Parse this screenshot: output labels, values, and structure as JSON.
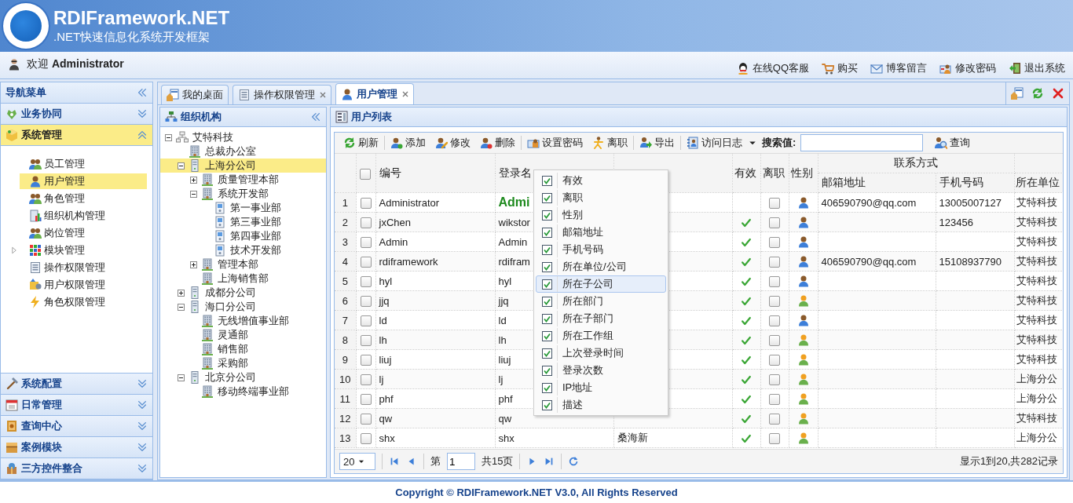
{
  "header": {
    "title": "RDIFramework.NET",
    "subtitle": ".NET快速信息化系统开发框架"
  },
  "welcome": {
    "prefix": "欢迎",
    "user": "Administrator"
  },
  "top_links": [
    "在线QQ客服",
    "购买",
    "博客留言",
    "修改密码",
    "退出系统"
  ],
  "nav": {
    "title": "导航菜单",
    "sections": [
      {
        "label": "业务协同",
        "expanded": false,
        "selected": false
      },
      {
        "label": "系统管理",
        "expanded": true,
        "selected": true,
        "items": [
          {
            "label": "员工管理",
            "selected": false
          },
          {
            "label": "用户管理",
            "selected": true
          },
          {
            "label": "角色管理",
            "selected": false
          },
          {
            "label": "组织机构管理",
            "selected": false
          },
          {
            "label": "岗位管理",
            "selected": false
          },
          {
            "label": "模块管理",
            "selected": false,
            "expanded": false
          },
          {
            "label": "操作权限管理",
            "selected": false
          },
          {
            "label": "用户权限管理",
            "selected": false
          },
          {
            "label": "角色权限管理",
            "selected": false
          }
        ]
      },
      {
        "label": "系统配置",
        "expanded": false,
        "selected": false
      },
      {
        "label": "日常管理",
        "expanded": false,
        "selected": false
      },
      {
        "label": "查询中心",
        "expanded": false,
        "selected": false
      },
      {
        "label": "案例模块",
        "expanded": false,
        "selected": false
      },
      {
        "label": "三方控件整合",
        "expanded": false,
        "selected": false
      }
    ]
  },
  "tabs": [
    {
      "label": "我的桌面",
      "closable": false,
      "selected": false
    },
    {
      "label": "操作权限管理",
      "closable": true,
      "selected": false
    },
    {
      "label": "用户管理",
      "closable": true,
      "selected": true
    }
  ],
  "tree": {
    "title": "组织机构",
    "nodes": [
      {
        "label": "艾特科技",
        "kind": "root",
        "expanded": true,
        "selected": false,
        "children": [
          {
            "label": "总裁办公室",
            "kind": "department",
            "selected": false
          },
          {
            "label": "上海分公司",
            "kind": "company",
            "expanded": true,
            "selected": true,
            "children": [
              {
                "label": "质量管理本部",
                "kind": "department",
                "expanded": false,
                "selected": false
              },
              {
                "label": "系统开发部",
                "kind": "department",
                "expanded": true,
                "selected": false,
                "children": [
                  {
                    "label": "第一事业部",
                    "kind": "unit",
                    "selected": false
                  },
                  {
                    "label": "第三事业部",
                    "kind": "unit",
                    "selected": false
                  },
                  {
                    "label": "第四事业部",
                    "kind": "unit",
                    "selected": false
                  },
                  {
                    "label": "技术开发部",
                    "kind": "unit",
                    "selected": false
                  }
                ]
              },
              {
                "label": "管理本部",
                "kind": "department",
                "expanded": false,
                "selected": false
              },
              {
                "label": "上海销售部",
                "kind": "department",
                "selected": false
              }
            ]
          },
          {
            "label": "成都分公司",
            "kind": "company",
            "expanded": false,
            "selected": false
          },
          {
            "label": "海口分公司",
            "kind": "company",
            "expanded": true,
            "selected": false,
            "children": [
              {
                "label": "无线增值事业部",
                "kind": "department",
                "selected": false
              },
              {
                "label": "灵通部",
                "kind": "department",
                "selected": false
              },
              {
                "label": "销售部",
                "kind": "department",
                "selected": false
              },
              {
                "label": "采购部",
                "kind": "department",
                "selected": false
              }
            ]
          },
          {
            "label": "北京分公司",
            "kind": "company",
            "expanded": true,
            "selected": false,
            "children": [
              {
                "label": "移动终端事业部",
                "kind": "department",
                "selected": false
              }
            ]
          }
        ]
      }
    ]
  },
  "grid": {
    "title": "用户列表",
    "toolbar": [
      "刷新",
      "添加",
      "修改",
      "删除",
      "设置密码",
      "离职",
      "导出",
      "访问日志"
    ],
    "search": {
      "label": "搜索值:",
      "button": "查询"
    },
    "columns": [
      {
        "label": "编号"
      },
      {
        "label": "登录名"
      },
      {},
      {
        "label": "有效"
      },
      {
        "label": "离职"
      },
      {
        "label": "性别"
      },
      {
        "label": "联系方式",
        "children": [
          {
            "label": "邮箱地址"
          },
          {
            "label": "手机号码"
          }
        ]
      },
      {
        "label": "所在单位"
      }
    ],
    "all_checked": false,
    "rows": [
      {
        "num": "1",
        "checked": false,
        "code": "Administrator",
        "login": "Admi",
        "login_emphasized": true,
        "valid": false,
        "left": false,
        "female": false,
        "email": "406590790@qq.com",
        "mobile": "13005007127",
        "unit": "艾特科技"
      },
      {
        "num": "2",
        "checked": false,
        "code": "jxChen",
        "login": "wikstor",
        "login_emphasized": false,
        "valid": true,
        "left": false,
        "female": false,
        "mobile": "123456",
        "unit": "艾特科技"
      },
      {
        "num": "3",
        "checked": false,
        "code": "Admin",
        "login": "Admin",
        "login_emphasized": false,
        "valid": true,
        "left": false,
        "female": false,
        "unit": "艾特科技"
      },
      {
        "num": "4",
        "checked": false,
        "code": "rdiframework",
        "login": "rdifram",
        "login_emphasized": false,
        "valid": true,
        "left": false,
        "female": false,
        "email": "406590790@qq.com",
        "mobile": "15108937790",
        "unit": "艾特科技"
      },
      {
        "num": "5",
        "checked": false,
        "code": "hyl",
        "login": "hyl",
        "login_emphasized": false,
        "valid": true,
        "left": false,
        "female": false,
        "unit": "艾特科技"
      },
      {
        "num": "6",
        "checked": false,
        "code": "jjq",
        "login": "jjq",
        "login_emphasized": false,
        "valid": true,
        "left": false,
        "female": true,
        "unit": "艾特科技"
      },
      {
        "num": "7",
        "checked": false,
        "code": "ld",
        "login": "ld",
        "login_emphasized": false,
        "valid": true,
        "left": false,
        "female": false,
        "unit": "艾特科技"
      },
      {
        "num": "8",
        "checked": false,
        "code": "lh",
        "login": "lh",
        "login_emphasized": false,
        "valid": true,
        "left": false,
        "female": true,
        "unit": "艾特科技"
      },
      {
        "num": "9",
        "checked": false,
        "code": "liuj",
        "login": "liuj",
        "login_emphasized": false,
        "valid": true,
        "left": false,
        "female": true,
        "unit": "艾特科技"
      },
      {
        "num": "10",
        "checked": false,
        "code": "lj",
        "login": "lj",
        "login_emphasized": false,
        "valid": true,
        "left": false,
        "female": true,
        "unit": "上海分公"
      },
      {
        "num": "11",
        "checked": false,
        "code": "phf",
        "login": "phf",
        "login_emphasized": false,
        "valid": true,
        "left": false,
        "female": true,
        "unit": "上海分公"
      },
      {
        "num": "12",
        "checked": false,
        "code": "qw",
        "login": "qw",
        "login_emphasized": false,
        "valid": true,
        "left": false,
        "female": true,
        "unit": "艾特科技"
      },
      {
        "num": "13",
        "checked": false,
        "code": "shx",
        "login": "shx",
        "name": "桑海新",
        "login_emphasized": false,
        "valid": true,
        "left": false,
        "female": true,
        "unit": "上海分公"
      }
    ],
    "column_menu": [
      {
        "label": "有效",
        "checked": true,
        "highlighted": false
      },
      {
        "label": "离职",
        "checked": true,
        "highlighted": false
      },
      {
        "label": "性别",
        "checked": true,
        "highlighted": false
      },
      {
        "label": "邮箱地址",
        "checked": true,
        "highlighted": false
      },
      {
        "label": "手机号码",
        "checked": true,
        "highlighted": false
      },
      {
        "label": "所在单位/公司",
        "checked": true,
        "highlighted": false
      },
      {
        "label": "所在子公司",
        "checked": true,
        "highlighted": true
      },
      {
        "label": "所在部门",
        "checked": true,
        "highlighted": false
      },
      {
        "label": "所在子部门",
        "checked": true,
        "highlighted": false
      },
      {
        "label": "所在工作组",
        "checked": true,
        "highlighted": false
      },
      {
        "label": "上次登录时间",
        "checked": true,
        "highlighted": false
      },
      {
        "label": "登录次数",
        "checked": true,
        "highlighted": false
      },
      {
        "label": "IP地址",
        "checked": true,
        "highlighted": false
      },
      {
        "label": "描述",
        "checked": true,
        "highlighted": false
      }
    ],
    "pager": {
      "page_size": "20",
      "before": "第",
      "page": "1",
      "after": "共15页",
      "summary": "显示1到20,共282记录"
    }
  },
  "footer": "Copyright © RDIFramework.NET V3.0, All Rights Reserved"
}
